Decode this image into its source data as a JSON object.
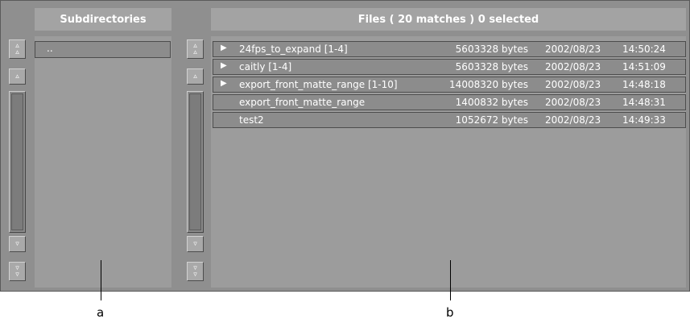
{
  "subdirectories": {
    "header": "Subdirectories",
    "items": [
      ".."
    ]
  },
  "files": {
    "header": "Files ( 20 matches ) 0 selected",
    "rows": [
      {
        "expandable": true,
        "name": "24fps_to_expand [1-4]",
        "size": "5603328 bytes",
        "date": "2002/08/23",
        "time": "14:50:24"
      },
      {
        "expandable": true,
        "name": "caitly [1-4]",
        "size": "5603328 bytes",
        "date": "2002/08/23",
        "time": "14:51:09"
      },
      {
        "expandable": true,
        "name": "export_front_matte_range [1-10]",
        "size": "14008320 bytes",
        "date": "2002/08/23",
        "time": "14:48:18"
      },
      {
        "expandable": false,
        "name": "export_front_matte_range",
        "size": "1400832 bytes",
        "date": "2002/08/23",
        "time": "14:48:31"
      },
      {
        "expandable": false,
        "name": "test2",
        "size": "1052672 bytes",
        "date": "2002/08/23",
        "time": "14:49:33"
      }
    ]
  },
  "scroll_glyphs": {
    "single_up": "▵",
    "single_down": "▿",
    "page_up": "▵▵",
    "page_down": "▿▿",
    "expand": "▶"
  },
  "callouts": {
    "a": "a",
    "b": "b"
  }
}
